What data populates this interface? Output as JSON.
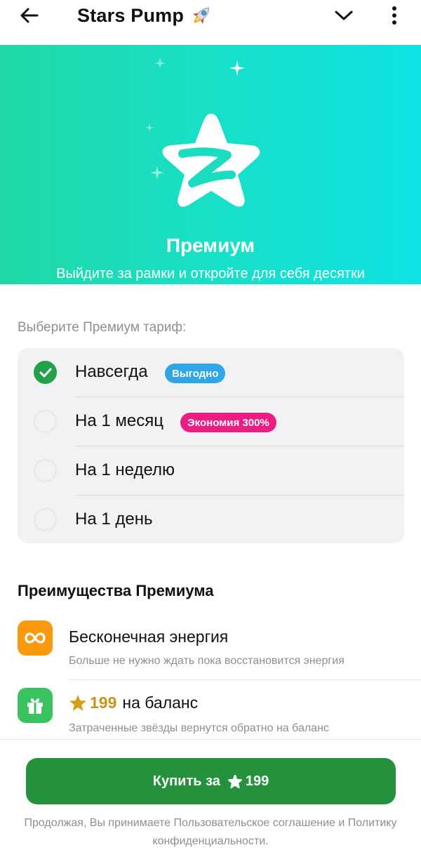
{
  "header": {
    "title": "Stars Pump",
    "icons": {
      "back": "arrow-left-icon",
      "emoji": "rocket-icon",
      "dropdown": "chevron-down-icon",
      "menu": "more-vertical-icon"
    }
  },
  "hero": {
    "title": "Премиум",
    "subtitle": "Выйдите за рамки и откройте для себя десятки эксклюзивных функций",
    "icon": "premium-star-icon",
    "gradient": [
      "#1fd8a6",
      "#0fe3e3"
    ]
  },
  "tariffs": {
    "label": "Выберите Премиум тариф:",
    "items": [
      {
        "label": "Навсегда",
        "badge": "Выгодно",
        "badge_color": "#2fa6e6",
        "selected": true
      },
      {
        "label": "На 1 месяц",
        "badge": "Экономия 300%",
        "badge_color": "#ec1c83",
        "selected": false
      },
      {
        "label": "На 1 неделю",
        "selected": false
      },
      {
        "label": "На 1 день",
        "selected": false
      }
    ]
  },
  "benefits": {
    "title": "Преимущества Премиума",
    "items": [
      {
        "icon": "infinity-icon",
        "icon_color": "#f89a0b",
        "title": "Бесконечная энергия",
        "subtitle": "Больше не нужно ждать пока восстановится энергия"
      },
      {
        "icon": "gift-icon",
        "icon_color": "#3ac160",
        "amount": "199",
        "title_suffix": "на баланс",
        "subtitle": "Затраченные звёзды вернутся обратно на баланс"
      }
    ]
  },
  "buy": {
    "label": "Купить за",
    "price": "199",
    "color": "#24913d"
  },
  "legal": "Продолжая, Вы принимаете Пользовательское соглашение и Политику конфиденциальности."
}
